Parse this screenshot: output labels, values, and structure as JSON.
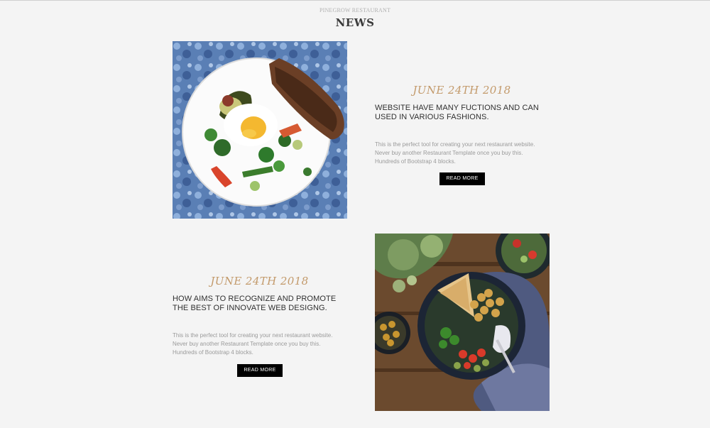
{
  "header": {
    "kicker": "PINEGROW RESTAURANT",
    "title": "NEWS"
  },
  "articles": [
    {
      "date": "June 24th 2018",
      "headline": "WEBSITE HAVE MANY FUCTIONS AND CAN USED IN VARIOUS FASHIONS.",
      "body": "This is the perfect tool for creating your next restaurant website. Never buy another Restaurant Template once you buy this. Hundreds of Bootstrap 4 blocks.",
      "button": "READ MORE"
    },
    {
      "date": "June 24th 2018",
      "headline": "HOW AIMS TO RECOGNIZE AND PROMOTE THE BEST OF INNOVATE WEB DESIGNG.",
      "body": "This is the perfect tool for creating your next restaurant website. Never buy another Restaurant Template once you buy this. Hundreds of Bootstrap 4 blocks.",
      "button": "READ MORE"
    }
  ],
  "colors": {
    "background": "#f4f4f4",
    "date_accent": "#c39a6b",
    "button_bg": "#000000",
    "button_text": "#ffffff"
  }
}
